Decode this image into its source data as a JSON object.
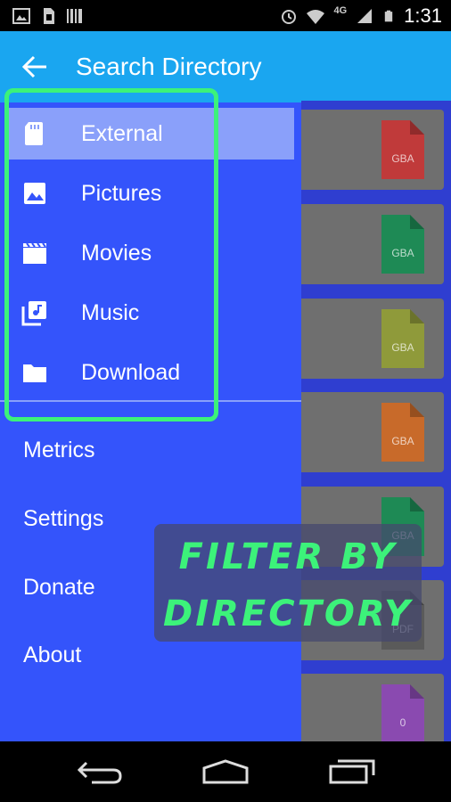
{
  "status_bar": {
    "time": "1:31",
    "network": "4G",
    "icons": [
      "image-icon",
      "sim-icon",
      "barcode-icon",
      "alarm-icon",
      "wifi-icon",
      "signal-icon",
      "battery-icon"
    ]
  },
  "drawer": {
    "title": "Search Directory",
    "directories": [
      {
        "label": "External",
        "icon": "sd-card-icon",
        "selected": true
      },
      {
        "label": "Pictures",
        "icon": "image-icon",
        "selected": false
      },
      {
        "label": "Movies",
        "icon": "movie-icon",
        "selected": false
      },
      {
        "label": "Music",
        "icon": "music-library-icon",
        "selected": false
      },
      {
        "label": "Download",
        "icon": "folder-icon",
        "selected": false
      }
    ],
    "menu": [
      {
        "label": "Metrics"
      },
      {
        "label": "Settings"
      },
      {
        "label": "Donate"
      },
      {
        "label": "About"
      }
    ]
  },
  "background_files": [
    {
      "label": "GBA",
      "color": "#c03a3a"
    },
    {
      "label": "GBA",
      "color": "#1e8a55"
    },
    {
      "label": "GBA",
      "color": "#8f9a3a"
    },
    {
      "label": "GBA",
      "color": "#c86a2a"
    },
    {
      "label": "GBA",
      "color": "#1e8a55"
    },
    {
      "label": "PDF",
      "color": "#5a5a5a"
    },
    {
      "label": "0",
      "color": "#8a4ab0"
    }
  ],
  "banner": {
    "line1": "FILTER BY",
    "line2": "DIRECTORY"
  },
  "colors": {
    "drawer_bg": "#3454fb",
    "header_bg": "#1aa6f0",
    "selected_bg": "#8aa0fa",
    "highlight": "#3cf27a"
  }
}
